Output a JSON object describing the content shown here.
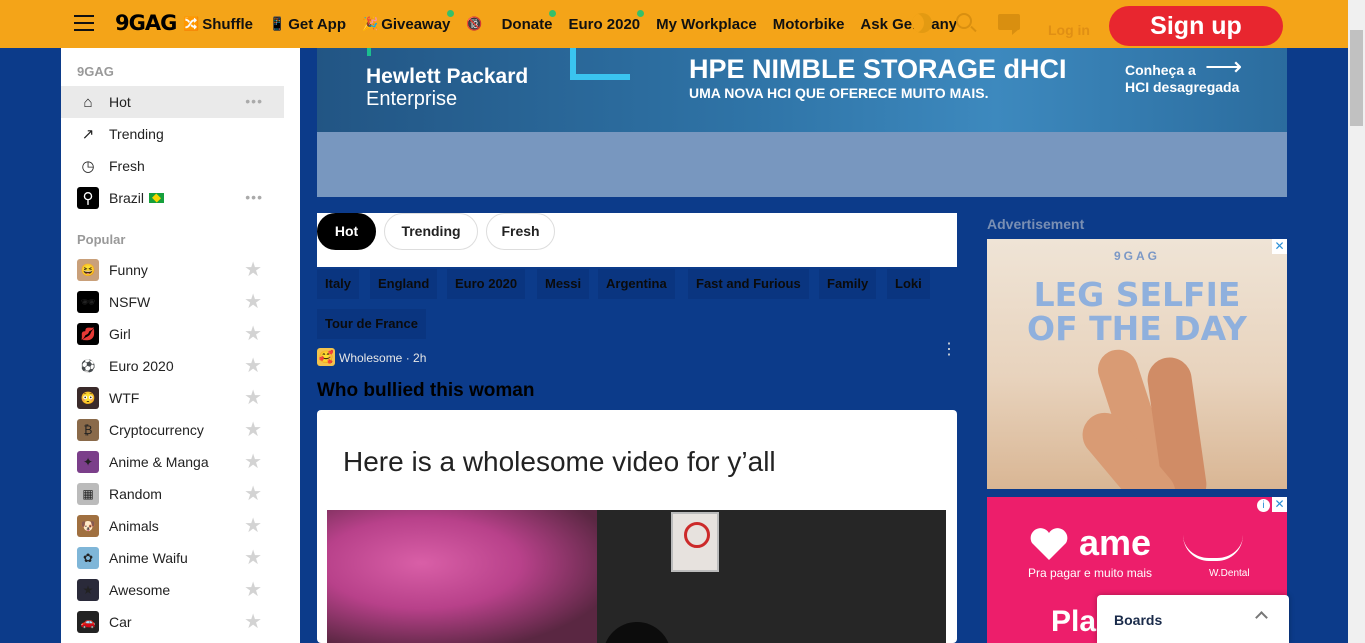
{
  "header": {
    "logo": "9GAG",
    "nav": [
      {
        "label": "Shuffle",
        "icon": "🔀",
        "dot": false
      },
      {
        "label": "Get App",
        "icon": "📱",
        "dot": false
      },
      {
        "label": "Giveaway",
        "icon": "🎉",
        "dot": true
      },
      {
        "label": "",
        "icon": "🔞",
        "dot": false
      },
      {
        "label": "Donate",
        "icon": "",
        "dot": true
      },
      {
        "label": "Euro 2020",
        "icon": "",
        "dot": true
      },
      {
        "label": "My Workplace",
        "icon": "",
        "dot": false
      },
      {
        "label": "Motorbike",
        "icon": "",
        "dot": false
      },
      {
        "label": "Ask Germany",
        "icon": "",
        "dot": false
      }
    ],
    "login": "Log in",
    "signup": "Sign up"
  },
  "sidebar": {
    "section1": "9GAG",
    "main_items": [
      {
        "label": "Hot",
        "icon": "⌂",
        "more": "•••"
      },
      {
        "label": "Trending",
        "icon": "↗",
        "more": ""
      },
      {
        "label": "Fresh",
        "icon": "◷",
        "more": ""
      },
      {
        "label": "Brazil",
        "icon": "⚲",
        "more": "•••"
      }
    ],
    "section2": "Popular",
    "popular_items": [
      {
        "label": "Funny",
        "icon": "😆",
        "color": "#c9a07a"
      },
      {
        "label": "NSFW",
        "icon": "🕶",
        "color": "#000000"
      },
      {
        "label": "Girl",
        "icon": "💋",
        "color": "#000000"
      },
      {
        "label": "Euro 2020",
        "icon": "⚽",
        "color": "#ffffff"
      },
      {
        "label": "WTF",
        "icon": "😳",
        "color": "#3a2a2a"
      },
      {
        "label": "Cryptocurrency",
        "icon": "₿",
        "color": "#8a6a4a"
      },
      {
        "label": "Anime & Manga",
        "icon": "✦",
        "color": "#7b3f8a"
      },
      {
        "label": "Random",
        "icon": "▦",
        "color": "#bbbbbb"
      },
      {
        "label": "Animals",
        "icon": "🐶",
        "color": "#a07040"
      },
      {
        "label": "Anime Waifu",
        "icon": "✿",
        "color": "#7fb6d8"
      },
      {
        "label": "Awesome",
        "icon": "★",
        "color": "#2a2a3a"
      },
      {
        "label": "Car",
        "icon": "🚗",
        "color": "#222222"
      }
    ],
    "star": "★"
  },
  "banner": {
    "brand1": "Hewlett Packard",
    "brand2": "Enterprise",
    "title": "HPE NIMBLE STORAGE dHCI",
    "subtitle": "UMA NOVA HCI QUE OFERECE MUITO MAIS.",
    "cta1": "Conheça a",
    "cta2": "HCI desagregada",
    "arrow": "⟶"
  },
  "tabs": [
    "Hot",
    "Trending",
    "Fresh"
  ],
  "tags": [
    "Italy",
    "England",
    "Euro 2020",
    "Messi",
    "Argentina",
    "Fast and Furious",
    "Family",
    "Loki",
    "Tour de France"
  ],
  "post": {
    "avatar": "🥰",
    "meta": "Wholesome · 2h",
    "menu": "⋮",
    "title": "Who bullied this woman",
    "caption": "Here is a wholesome video for y’all"
  },
  "right": {
    "adv_label": "Advertisement",
    "ad1": {
      "brand": "9GAG",
      "line1": "LEG SELFIE",
      "line2": "OF THE DAY",
      "close": "✕"
    },
    "ad2": {
      "brand": "ame",
      "sub": "Pra pagar e muito mais",
      "partner": "W.Dental",
      "cut": "Pla",
      "info": "i",
      "close": "✕"
    }
  },
  "boards": {
    "label": "Boards"
  }
}
